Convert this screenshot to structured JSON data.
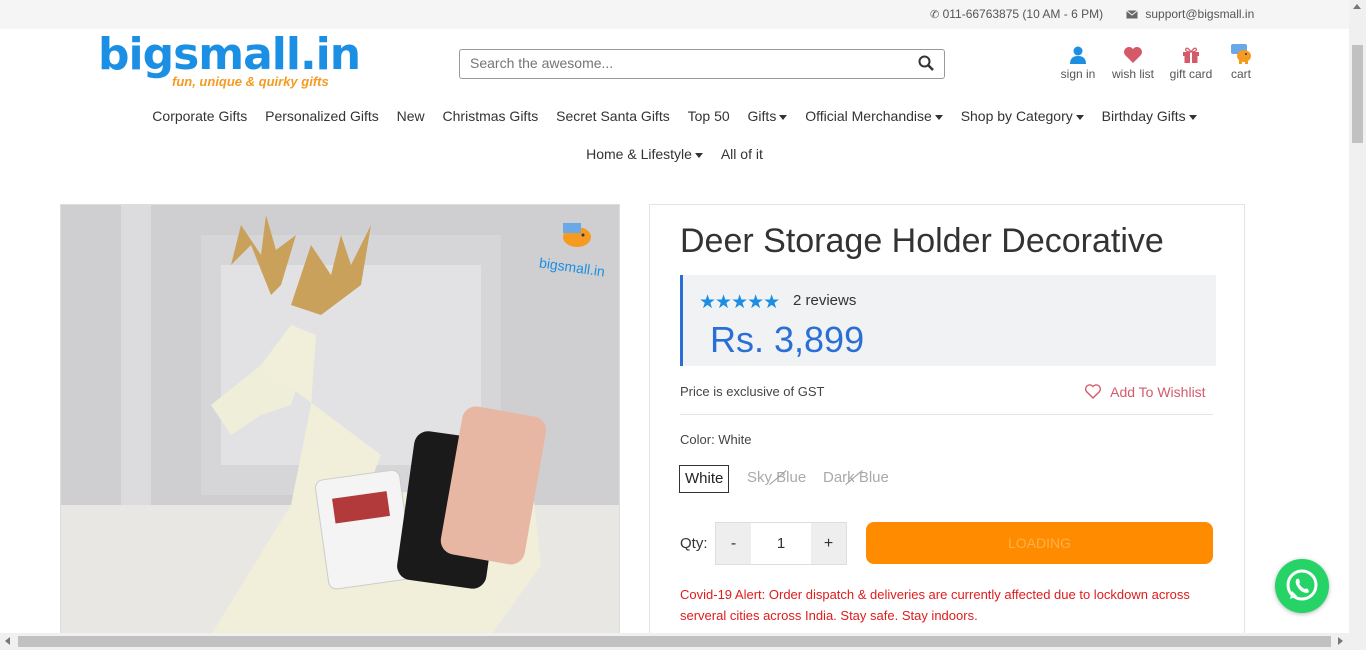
{
  "topbar": {
    "phone": "011-66763875 (10 AM - 6 PM)",
    "email": "support@bigsmall.in"
  },
  "logo": {
    "name": "bigsmall.in",
    "tagline": "fun, unique & quirky gifts"
  },
  "search": {
    "placeholder": "Search the awesome..."
  },
  "header_icons": {
    "signin": "sign in",
    "wishlist": "wish list",
    "giftcard": "gift card",
    "cart": "cart"
  },
  "nav": {
    "row1": [
      {
        "label": "Corporate Gifts"
      },
      {
        "label": "Personalized Gifts"
      },
      {
        "label": "New"
      },
      {
        "label": "Christmas Gifts"
      },
      {
        "label": "Secret Santa Gifts"
      },
      {
        "label": "Top 50"
      },
      {
        "label": "Gifts"
      },
      {
        "label": "Official Merchandise"
      },
      {
        "label": "Shop by Category"
      },
      {
        "label": "Birthday Gifts"
      }
    ],
    "row2": [
      {
        "label": "Home & Lifestyle"
      },
      {
        "label": "All of it"
      }
    ]
  },
  "product": {
    "title": "Deer Storage Holder Decorative",
    "rating": 5,
    "stars": "★★★★★",
    "reviews": "2 reviews",
    "price": "Rs. 3,899",
    "gst_note": "Price is exclusive of GST",
    "wishlist_label": "Add To Wishlist",
    "color_label": "Color: White",
    "colors": [
      {
        "label": "White",
        "available": true
      },
      {
        "label": "Sky Blue",
        "available": false
      },
      {
        "label": "Dark Blue",
        "available": false
      }
    ],
    "qty_label": "Qty:",
    "qty_minus": "-",
    "qty_value": "1",
    "qty_plus": "+",
    "add_button": "LOADING",
    "covid_alert": "Covid-19 Alert: Order dispatch & deliveries are currently affected due to lockdown across serveral cities across India. Stay safe. Stay indoors."
  },
  "image_watermark": "bigsmall.in",
  "colors": {
    "brand_blue": "#1a8fe3",
    "brand_orange": "#f59b21",
    "price_blue": "#2a6fd6",
    "button_orange": "#ff8c00",
    "alert_red": "#e01b1b",
    "whatsapp_green": "#25d366"
  }
}
